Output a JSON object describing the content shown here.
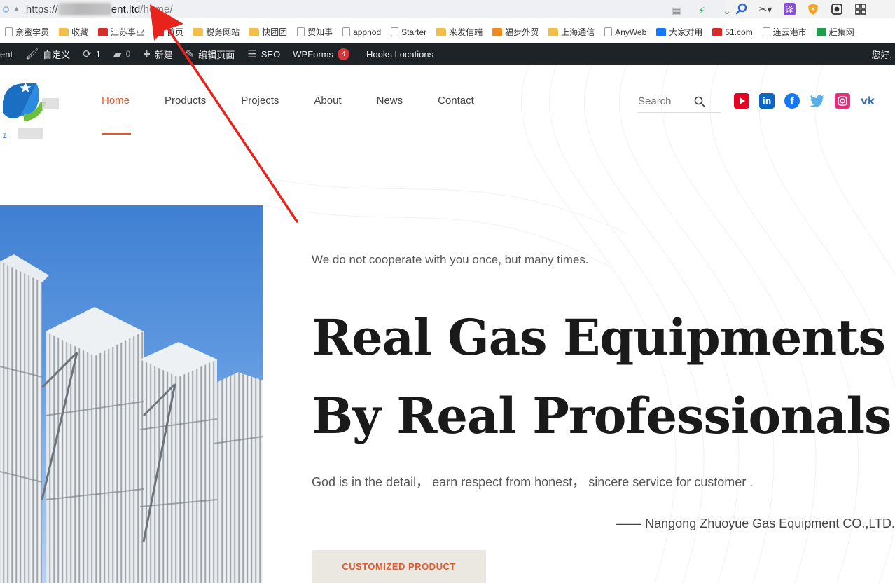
{
  "browser": {
    "url_scheme": "https://",
    "url_host_visible": "ent.ltd",
    "url_path": "/home/",
    "extension_icons": [
      "qr-icon",
      "lightning-icon",
      "chevron-down-icon",
      "search-icon",
      "scissors-icon",
      "translate-icon",
      "shield-icon",
      "record-icon",
      "grid-icon"
    ],
    "translate_label": "译"
  },
  "bookmarks": [
    {
      "label": "奈蜜学员",
      "icon": "page"
    },
    {
      "label": "收藏",
      "icon": "folder"
    },
    {
      "label": "江苏事业",
      "icon": "sq-red"
    },
    {
      "label": "首页",
      "icon": "sq-red"
    },
    {
      "label": "税务网站",
      "icon": "folder"
    },
    {
      "label": "快团团",
      "icon": "folder"
    },
    {
      "label": "贸知事",
      "icon": "page"
    },
    {
      "label": "appnod",
      "icon": "page"
    },
    {
      "label": "Starter",
      "icon": "page"
    },
    {
      "label": "来发信端",
      "icon": "folder"
    },
    {
      "label": "福步外贸",
      "icon": "sq-orange"
    },
    {
      "label": "上海通信",
      "icon": "folder"
    },
    {
      "label": "AnyWeb",
      "icon": "page"
    },
    {
      "label": "大家对用",
      "icon": "sq-blue"
    },
    {
      "label": "51.com",
      "icon": "sq-red"
    },
    {
      "label": "连云港市",
      "icon": "page"
    },
    {
      "label": "赶集网",
      "icon": "sq-green"
    }
  ],
  "wpbar": {
    "items": [
      {
        "label": "ent",
        "glyph": ""
      },
      {
        "label": "自定义",
        "glyph": "✎"
      },
      {
        "label": "1",
        "glyph": "⟳"
      },
      {
        "label": "0",
        "glyph": "■"
      },
      {
        "label": "新建",
        "glyph": "+"
      },
      {
        "label": "编辑页面",
        "glyph": "✎"
      },
      {
        "label": "SEO",
        "glyph": "☰"
      },
      {
        "label": "WPForms",
        "glyph": ""
      },
      {
        "label": "Hooks Locations",
        "glyph": ""
      }
    ],
    "wpforms_badge": "4",
    "greeting": "您好,"
  },
  "nav": {
    "items": [
      "Home",
      "Products",
      "Projects",
      "About",
      "News",
      "Contact"
    ],
    "active": "Home"
  },
  "search": {
    "placeholder": "Search"
  },
  "social": [
    {
      "name": "youtube-icon",
      "color": "#e60023"
    },
    {
      "name": "linkedin-icon",
      "color": "#0a66c2"
    },
    {
      "name": "facebook-icon",
      "color": "#1877f2"
    },
    {
      "name": "twitter-icon",
      "color": "#5aaee8"
    },
    {
      "name": "instagram-icon",
      "color": "#e4307c"
    },
    {
      "name": "vk-icon",
      "color": "#3f6ea8"
    }
  ],
  "hero": {
    "tagline": "We do not cooperate with you once, but many times.",
    "headline_line1": "Real Gas Equipments",
    "headline_line2": "By Real Professionals",
    "sub": "God is in the detail， earn respect from honest， sincere service for customer .",
    "signature": "—— Nangong Zhuoyue Gas Equipment CO.,LTD.",
    "cta": "CUSTOMIZED PRODUCT"
  },
  "colors": {
    "accent": "#e25a2b",
    "wp_bar": "#1d2327",
    "annotation_arrow": "#e8231b"
  }
}
